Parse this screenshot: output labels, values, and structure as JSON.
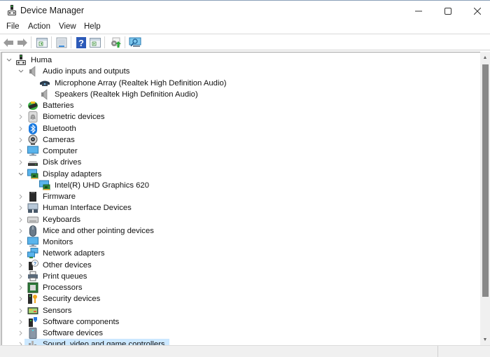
{
  "window": {
    "title": "Device Manager",
    "minimize_glyph": "—",
    "maximize_glyph": "☐",
    "close_glyph": "✕"
  },
  "menu": [
    {
      "label": "File"
    },
    {
      "label": "Action"
    },
    {
      "label": "View"
    },
    {
      "label": "Help"
    }
  ],
  "toolbar": [
    {
      "name": "back-button",
      "icon": "arrow-left-icon"
    },
    {
      "name": "forward-button",
      "icon": "arrow-right-icon"
    },
    {
      "name": "show-hide-console-tree-button",
      "icon": "console-tree-icon"
    },
    {
      "name": "properties-button",
      "icon": "properties-icon"
    },
    {
      "name": "help-button",
      "icon": "help-icon"
    },
    {
      "name": "show-action-pane-button",
      "icon": "action-pane-icon"
    },
    {
      "name": "update-driver-button",
      "icon": "update-driver-icon"
    },
    {
      "name": "scan-hardware-button",
      "icon": "scan-monitor-icon"
    }
  ],
  "tree": {
    "root": {
      "label": "Huma",
      "expanded": true
    },
    "items": [
      {
        "label": "Audio inputs and outputs",
        "icon": "speaker-icon",
        "expanded": true,
        "level": 1
      },
      {
        "label": "Microphone Array (Realtek High Definition Audio)",
        "icon": "microphone-array-icon",
        "level": 2
      },
      {
        "label": "Speakers (Realtek High Definition Audio)",
        "icon": "speaker-icon",
        "level": 2
      },
      {
        "label": "Batteries",
        "icon": "battery-icon",
        "expanded": false,
        "level": 1
      },
      {
        "label": "Biometric devices",
        "icon": "fingerprint-icon",
        "expanded": false,
        "level": 1
      },
      {
        "label": "Bluetooth",
        "icon": "bluetooth-icon",
        "expanded": false,
        "level": 1
      },
      {
        "label": "Cameras",
        "icon": "camera-icon",
        "expanded": false,
        "level": 1
      },
      {
        "label": "Computer",
        "icon": "computer-icon",
        "expanded": false,
        "level": 1
      },
      {
        "label": "Disk drives",
        "icon": "disk-drive-icon",
        "expanded": false,
        "level": 1
      },
      {
        "label": "Display adapters",
        "icon": "display-adapter-icon",
        "expanded": true,
        "level": 1
      },
      {
        "label": "Intel(R) UHD Graphics 620",
        "icon": "display-adapter-icon",
        "level": 2
      },
      {
        "label": "Firmware",
        "icon": "firmware-icon",
        "expanded": false,
        "level": 1
      },
      {
        "label": "Human Interface Devices",
        "icon": "hid-icon",
        "expanded": false,
        "level": 1
      },
      {
        "label": "Keyboards",
        "icon": "keyboard-icon",
        "expanded": false,
        "level": 1
      },
      {
        "label": "Mice and other pointing devices",
        "icon": "mouse-icon",
        "expanded": false,
        "level": 1
      },
      {
        "label": "Monitors",
        "icon": "monitor-icon",
        "expanded": false,
        "level": 1
      },
      {
        "label": "Network adapters",
        "icon": "network-adapter-icon",
        "expanded": false,
        "level": 1
      },
      {
        "label": "Other devices",
        "icon": "unknown-device-icon",
        "expanded": false,
        "level": 1
      },
      {
        "label": "Print queues",
        "icon": "printer-icon",
        "expanded": false,
        "level": 1
      },
      {
        "label": "Processors",
        "icon": "processor-icon",
        "expanded": false,
        "level": 1
      },
      {
        "label": "Security devices",
        "icon": "security-key-icon",
        "expanded": false,
        "level": 1
      },
      {
        "label": "Sensors",
        "icon": "sensor-icon",
        "expanded": false,
        "level": 1
      },
      {
        "label": "Software components",
        "icon": "software-component-icon",
        "expanded": false,
        "level": 1
      },
      {
        "label": "Software devices",
        "icon": "software-device-icon",
        "expanded": false,
        "level": 1
      },
      {
        "label": "Sound, video and game controllers",
        "icon": "sound-controller-icon",
        "expanded": false,
        "level": 1,
        "selected": true
      }
    ]
  },
  "colors": {
    "selection": "#cce8ff",
    "scroll_thumb": "#8a8a8a",
    "statusbar": "#f0f0f0"
  }
}
